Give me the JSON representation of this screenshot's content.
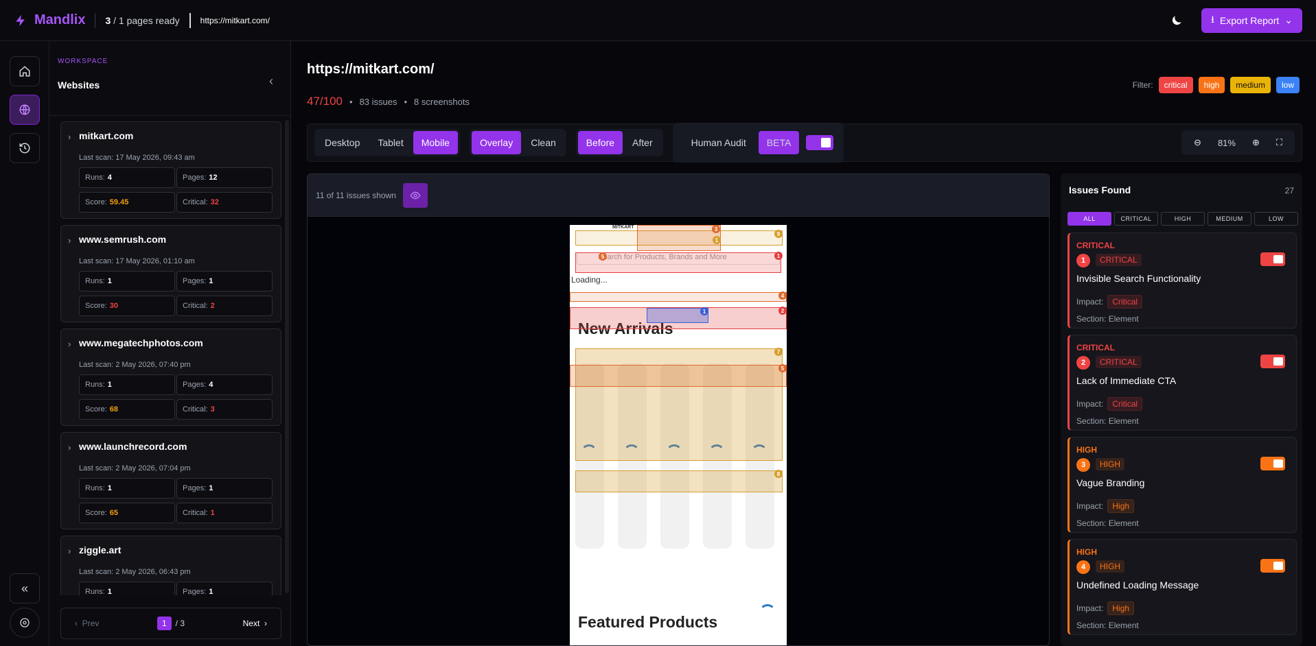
{
  "header": {
    "brand": "Mandlix",
    "pages_ready": "3",
    "pages_total": " / 1 pages ready",
    "url": "https://mitkart.com/",
    "export_label": "Export Report"
  },
  "workspace": {
    "label": "WORKSPACE",
    "title": "Websites"
  },
  "sites": [
    {
      "name": "mitkart.com",
      "last_scan": "Last scan: 17 May 2026, 09:43 am",
      "runs": "4",
      "pages": "12",
      "score": "59.45",
      "critical": "32",
      "score_color": "#f59e0b"
    },
    {
      "name": "www.semrush.com",
      "last_scan": "Last scan: 17 May 2026, 01:10 am",
      "runs": "1",
      "pages": "1",
      "score": "30",
      "critical": "2",
      "score_color": "#ef4444"
    },
    {
      "name": "www.megatechphotos.com",
      "last_scan": "Last scan: 2 May 2026, 07:40 pm",
      "runs": "1",
      "pages": "4",
      "score": "68",
      "critical": "3",
      "score_color": "#f59e0b"
    },
    {
      "name": "www.launchrecord.com",
      "last_scan": "Last scan: 2 May 2026, 07:04 pm",
      "runs": "1",
      "pages": "1",
      "score": "65",
      "critical": "1",
      "score_color": "#f59e0b"
    },
    {
      "name": "ziggle.art",
      "last_scan": "Last scan: 2 May 2026, 06:43 pm",
      "runs": "1",
      "pages": "1",
      "score": "",
      "critical": "",
      "score_color": "#f59e0b"
    }
  ],
  "labels": {
    "runs": "Runs:",
    "pages": "Pages:",
    "score": "Score:",
    "critical": "Critical:"
  },
  "pager": {
    "prev": "Prev",
    "current": "1",
    "total": "/ 3",
    "next": "Next"
  },
  "main": {
    "url": "https://mitkart.com/",
    "score": "47/100",
    "issues": "83 issues",
    "screenshots": "8 screenshots",
    "filter_label": "Filter:"
  },
  "filters": [
    {
      "label": "critical",
      "color": "#ef4444"
    },
    {
      "label": "high",
      "color": "#f97316"
    },
    {
      "label": "medium",
      "color": "#eab308"
    },
    {
      "label": "low",
      "color": "#3b82f6"
    }
  ],
  "devices": [
    "Desktop",
    "Tablet",
    "Mobile"
  ],
  "views": [
    "Overlay",
    "Clean"
  ],
  "modes": [
    "Before",
    "After"
  ],
  "audit": {
    "label": "Human Audit",
    "beta": "BETA",
    "enabled": true
  },
  "zoom": "81%",
  "viewer": {
    "shown": "11 of 11 issues shown"
  },
  "phone": {
    "search": "Search for Products, Brands and More",
    "loading": "Loading...",
    "new_arrivals": "New Arrivals",
    "featured": "Featured Products",
    "logo": "MITKART"
  },
  "issues_panel": {
    "title": "Issues Found",
    "count": "27",
    "tabs": [
      "ALL",
      "CRITICAL",
      "HIGH",
      "MEDIUM",
      "LOW"
    ],
    "impact_label": "Impact:",
    "section_label": "Section: Element"
  },
  "issues": [
    {
      "severity": "CRITICAL",
      "num": "1",
      "tag": "CRITICAL",
      "title": "Invisible Search Functionality",
      "impact": "Critical",
      "color": "#ef4444"
    },
    {
      "severity": "CRITICAL",
      "num": "2",
      "tag": "CRITICAL",
      "title": "Lack of Immediate CTA",
      "impact": "Critical",
      "color": "#ef4444"
    },
    {
      "severity": "HIGH",
      "num": "3",
      "tag": "HIGH",
      "title": "Vague Branding",
      "impact": "High",
      "color": "#f97316"
    },
    {
      "severity": "HIGH",
      "num": "4",
      "tag": "HIGH",
      "title": "Undefined Loading Message",
      "impact": "High",
      "color": "#f97316"
    }
  ]
}
